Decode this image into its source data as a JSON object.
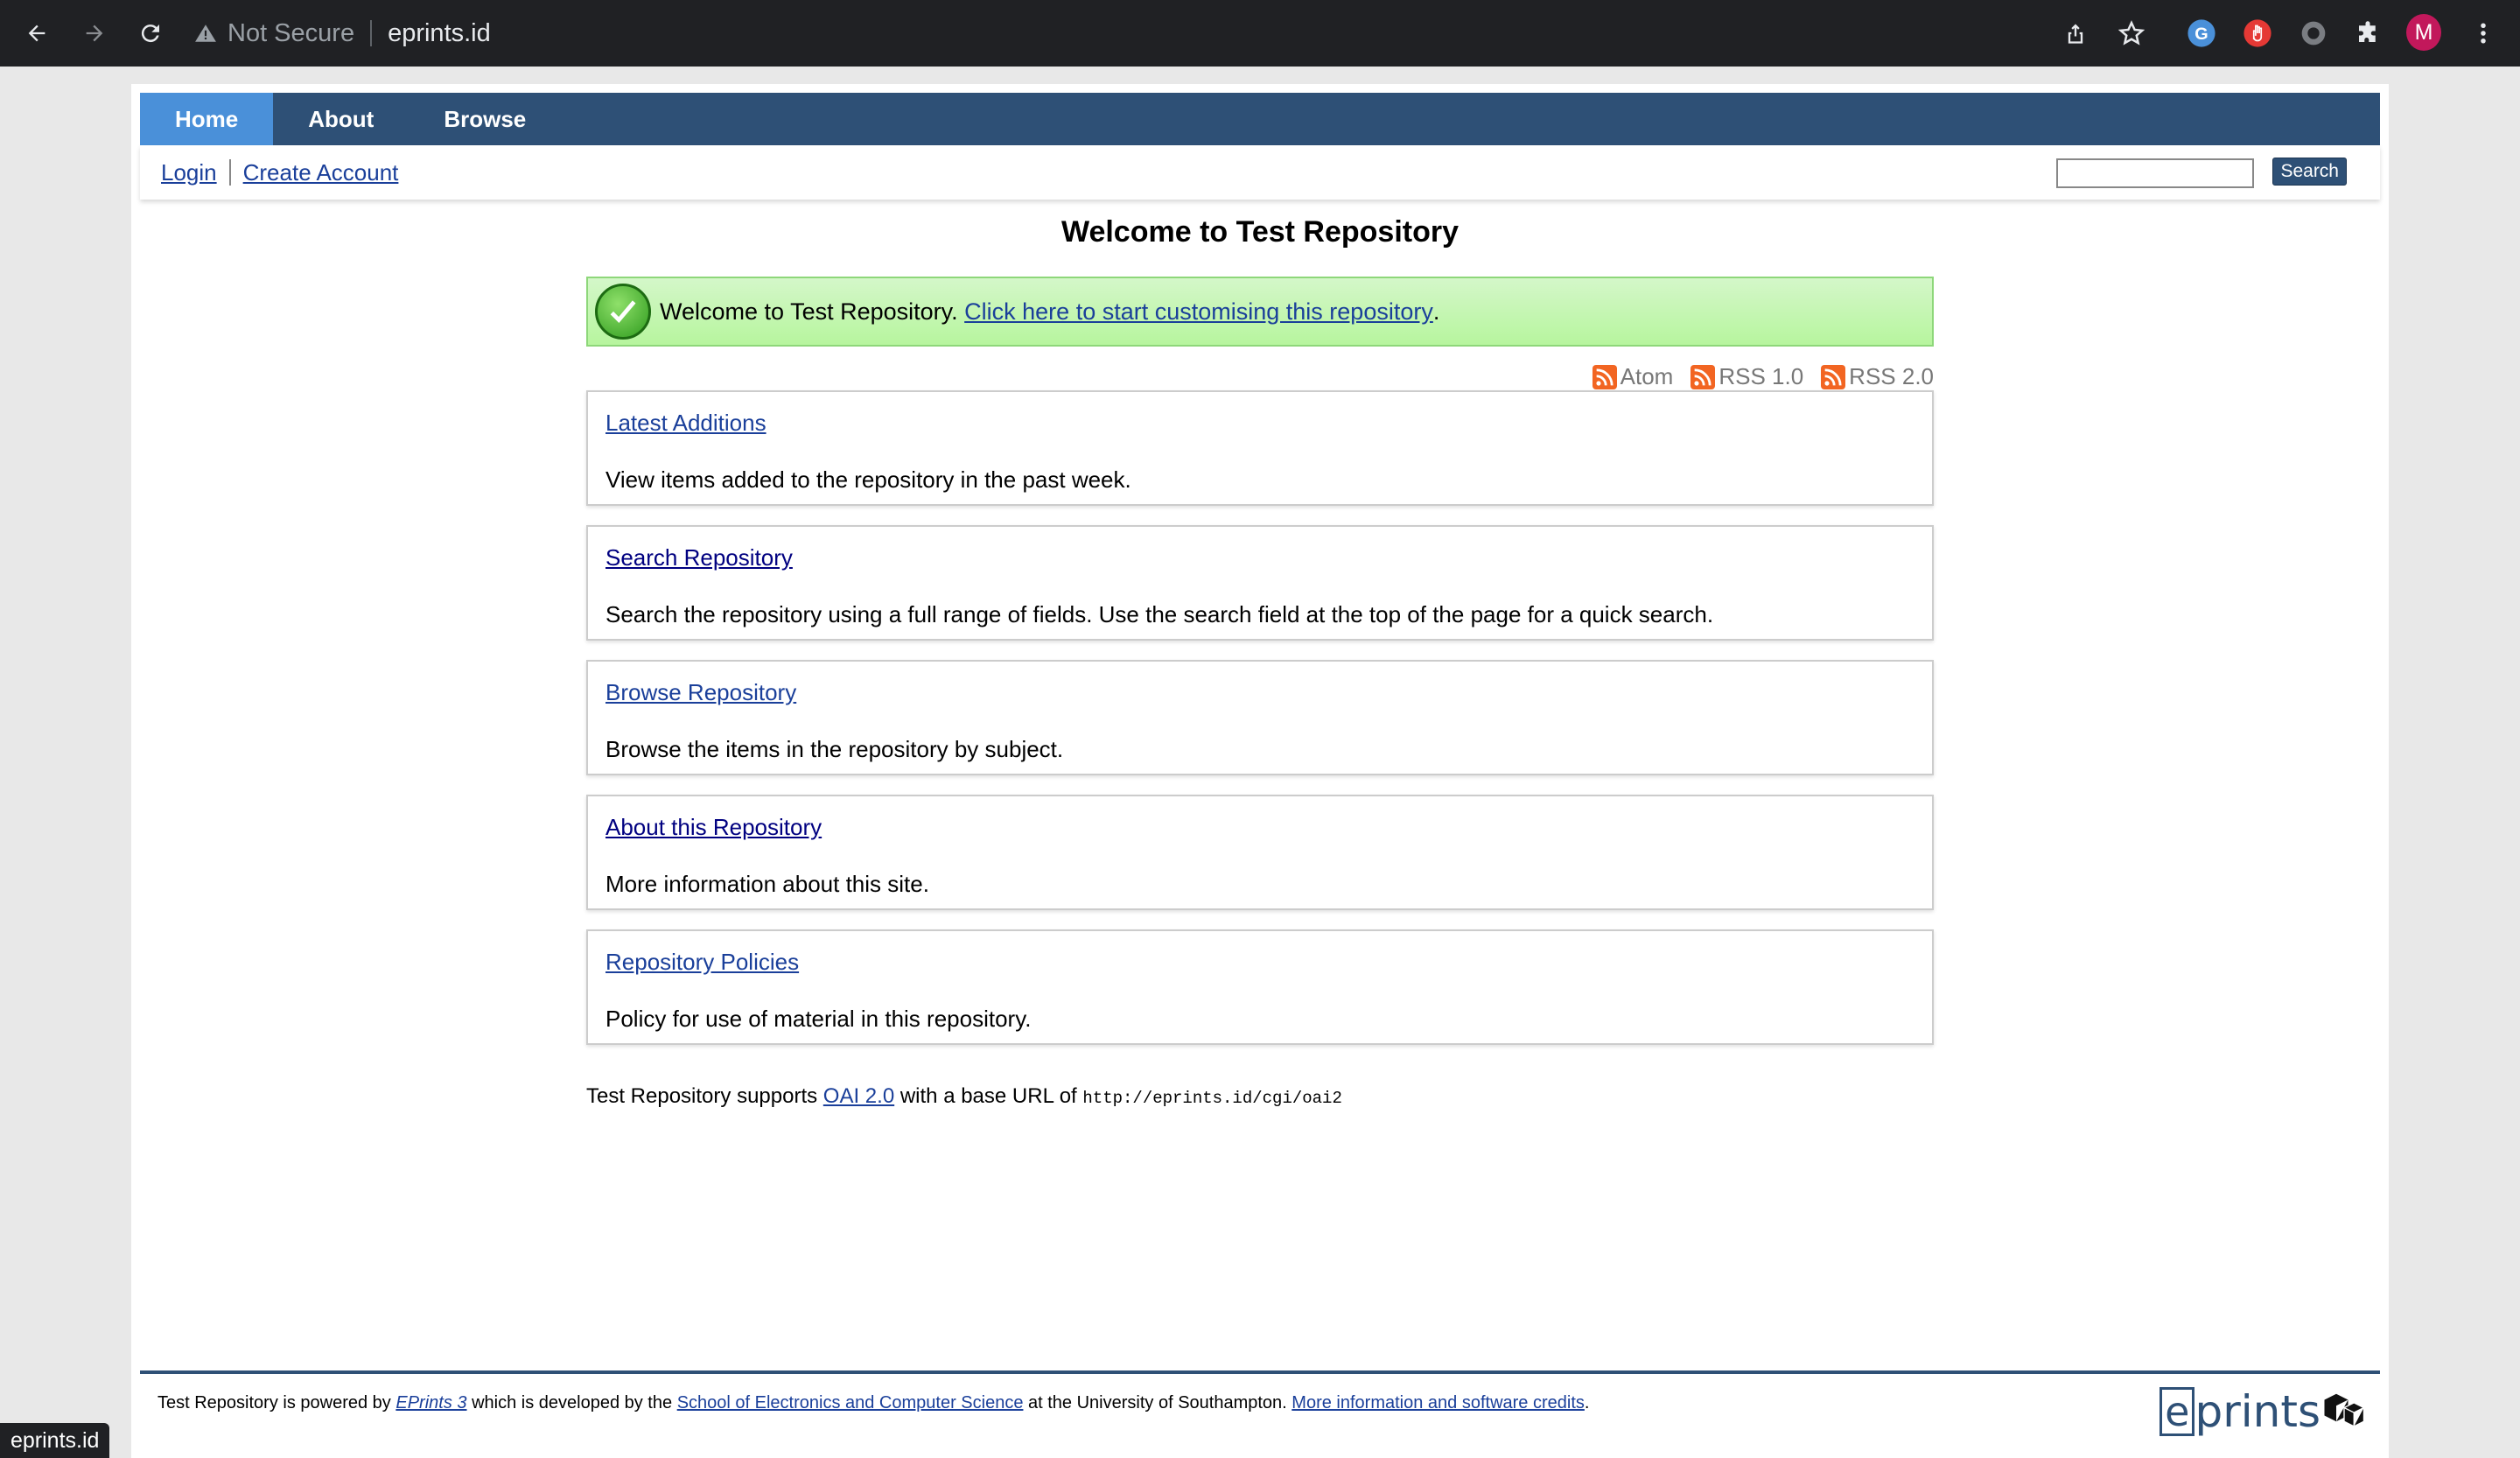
{
  "browser": {
    "security_label": "Not Secure",
    "url": "eprints.id",
    "profile_initial": "M",
    "status_url": "eprints.id"
  },
  "nav": {
    "tabs": [
      "Home",
      "About",
      "Browse"
    ],
    "login": "Login",
    "create_account": "Create Account",
    "search_value": "",
    "search_button": "Search"
  },
  "page": {
    "title": "Welcome to Test Repository",
    "welcome_text": "Welcome to Test Repository.",
    "welcome_link": "Click here to start customising this repository",
    "welcome_end": "."
  },
  "feeds": [
    "Atom",
    "RSS 1.0",
    "RSS 2.0"
  ],
  "sections": [
    {
      "link": "Latest Additions",
      "desc": "View items added to the repository in the past week."
    },
    {
      "link": "Search Repository",
      "desc": "Search the repository using a full range of fields. Use the search field at the top of the page for a quick search."
    },
    {
      "link": "Browse Repository",
      "desc": "Browse the items in the repository by subject."
    },
    {
      "link": "About this Repository",
      "desc": "More information about this site."
    },
    {
      "link": "Repository Policies",
      "desc": "Policy for use of material in this repository."
    }
  ],
  "oai": {
    "prefix": "Test Repository supports",
    "link": "OAI 2.0",
    "middle": "with a base URL of",
    "url": "http://eprints.id/cgi/oai2"
  },
  "footer": {
    "t1": "Test Repository is powered by",
    "eprints_link": "EPrints 3",
    "t2": "which is developed by the",
    "school_link": "School of Electronics and Computer Science",
    "t3": "at the University of Southampton.",
    "credits_link": "More information and software credits",
    "t4": ".",
    "logo_e": "e",
    "logo_rest": "prints"
  }
}
